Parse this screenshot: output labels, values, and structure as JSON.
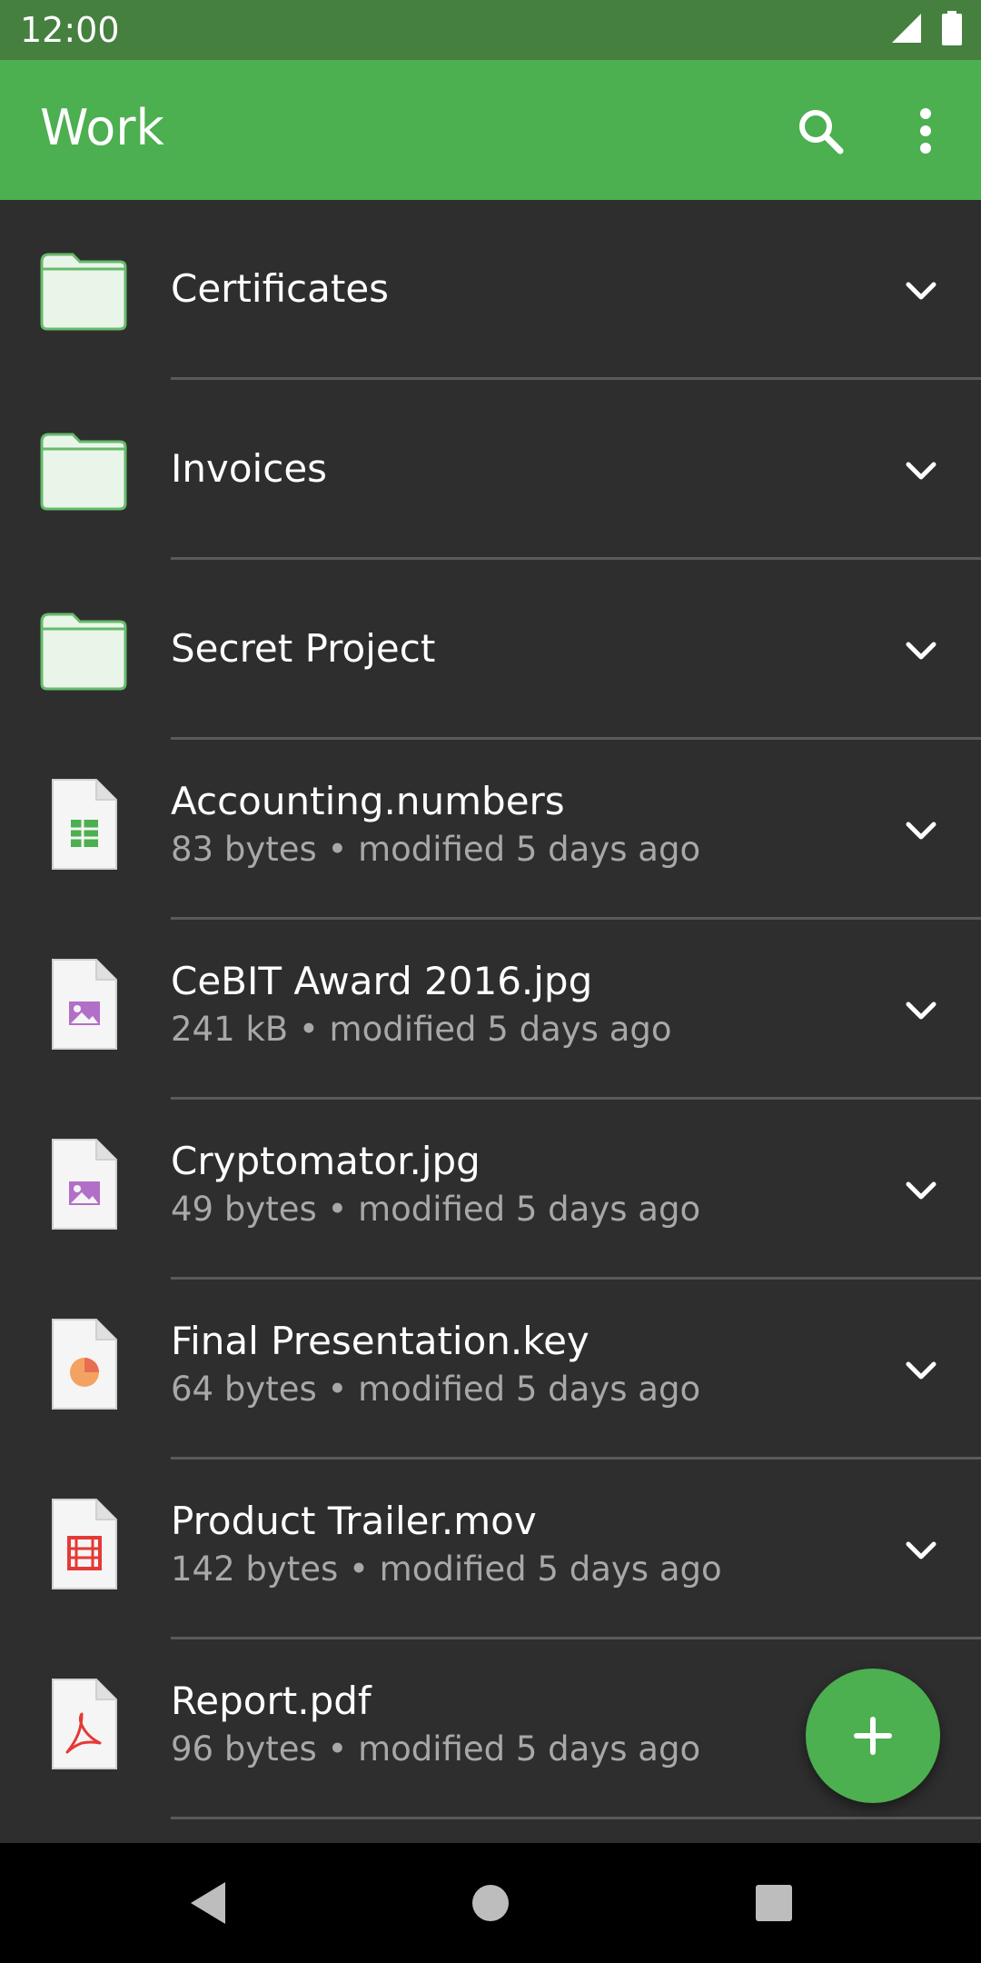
{
  "status_bar": {
    "time": "12:00",
    "icons": [
      "cell-signal-icon",
      "battery-icon"
    ]
  },
  "app_bar": {
    "title": "Work",
    "actions": [
      "search-icon",
      "more-vert-icon"
    ],
    "color": "#4caf50",
    "status_color": "#45803f"
  },
  "items": [
    {
      "type": "folder",
      "name": "Certificates",
      "meta": "",
      "icon": "folder-icon"
    },
    {
      "type": "folder",
      "name": "Invoices",
      "meta": "",
      "icon": "folder-icon"
    },
    {
      "type": "folder",
      "name": "Secret Project",
      "meta": "",
      "icon": "folder-icon"
    },
    {
      "type": "file",
      "name": "Accounting.numbers",
      "meta": "83 bytes • modified 5 days ago",
      "icon": "spreadsheet-file-icon"
    },
    {
      "type": "file",
      "name": "CeBIT Award 2016.jpg",
      "meta": "241 kB • modified 5 days ago",
      "icon": "image-file-icon"
    },
    {
      "type": "file",
      "name": "Cryptomator.jpg",
      "meta": "49 bytes • modified 5 days ago",
      "icon": "image-file-icon"
    },
    {
      "type": "file",
      "name": "Final Presentation.key",
      "meta": "64 bytes • modified 5 days ago",
      "icon": "presentation-file-icon"
    },
    {
      "type": "file",
      "name": "Product Trailer.mov",
      "meta": "142 bytes • modified 5 days ago",
      "icon": "video-file-icon"
    },
    {
      "type": "file",
      "name": "Report.pdf",
      "meta": "96 bytes • modified 5 days ago",
      "icon": "pdf-file-icon"
    }
  ],
  "fab": {
    "icon": "add-icon",
    "color": "#4caf50"
  },
  "nav_bar": {
    "icons": [
      "back-icon",
      "home-icon",
      "recents-icon"
    ]
  }
}
